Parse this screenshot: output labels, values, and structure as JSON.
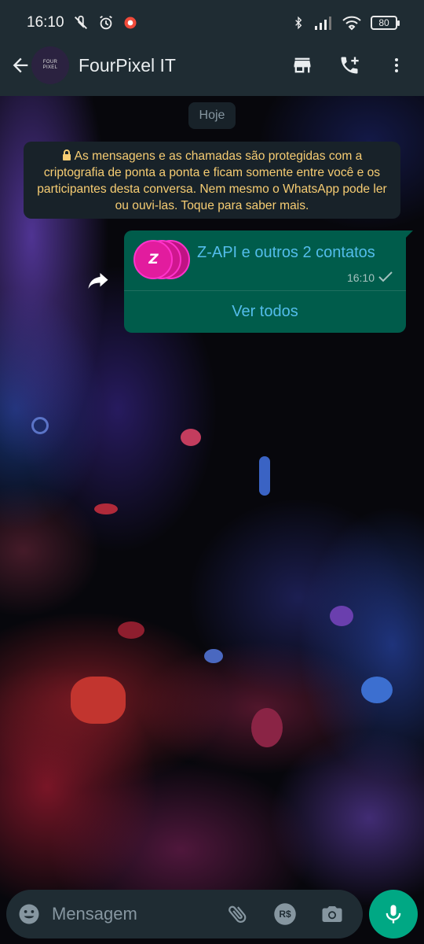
{
  "status_bar": {
    "time": "16:10",
    "battery": "80",
    "icons_left": [
      "mute-icon",
      "alarm-icon",
      "record-icon"
    ],
    "icons_right": [
      "bluetooth-icon",
      "signal-icon",
      "wifi-icon",
      "battery-icon"
    ]
  },
  "header": {
    "contact_name": "FourPixel IT",
    "avatar_text": "FOUR\nPIXEL",
    "actions": [
      "store-icon",
      "add-call-icon",
      "more-vert-icon"
    ]
  },
  "chat": {
    "date_label": "Hoje",
    "encryption_notice": "As mensagens e as chamadas são protegidas com a criptografia de ponta a ponta e ficam somente entre você e os participantes desta conversa. Nem mesmo o WhatsApp pode ler ou ouvi-las. Toque para saber mais.",
    "message": {
      "title": "Z-API e outros 2 contatos",
      "time": "16:10",
      "status": "sent",
      "action": "Ver todos",
      "avatar_text": "Z"
    }
  },
  "composer": {
    "placeholder": "Mensagem",
    "actions": [
      "attach-icon",
      "payment-icon",
      "camera-icon"
    ],
    "payment_label": "R$"
  },
  "colors": {
    "bar_bg": "#1f2c33",
    "bubble_out": "#005c4b",
    "link": "#53bdeb",
    "notice_text": "#f7cd73",
    "accent": "#00a884",
    "avatar_pink": "#e21c9e"
  }
}
